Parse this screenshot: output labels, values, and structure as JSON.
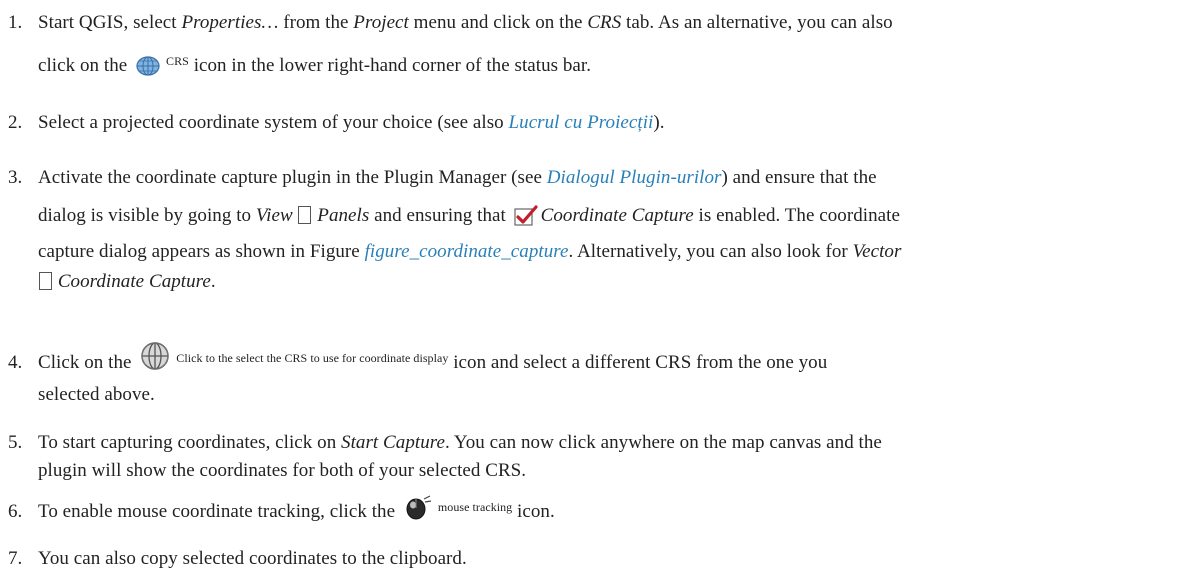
{
  "steps": [
    {
      "num": "1.",
      "p1": "Start QGIS, select ",
      "properties": "Properties…",
      "p2": " from the ",
      "project": "Project",
      "p3": " menu and click on the ",
      "crs_tab": "CRS",
      "p4": " tab. As an alternative, you can also",
      "p5": "click on the ",
      "icon_label": "CRS",
      "p6": " icon in the lower right-hand corner of the status bar."
    },
    {
      "num": "2.",
      "p1": "Select a projected coordinate system of your choice (see also ",
      "link": "Lucrul cu Proiecții",
      "p2": ")."
    },
    {
      "num": "3.",
      "p1": "Activate the coordinate capture plugin in the Plugin Manager (see ",
      "link": "Dialogul Plugin-urilor",
      "p2": ") and ensure that the",
      "p3": "dialog is visible by going to ",
      "view": "View",
      "panels": "Panels",
      "p4": " and ensuring that ",
      "coord_capture": "Coordinate Capture",
      "p5": " is enabled. The coordinate",
      "p6": "capture dialog appears as shown in Figure ",
      "figure_link": "figure_coordinate_capture",
      "p7": ". Alternatively, you can also look for ",
      "vector": "Vector",
      "coord_capture2": "Coordinate Capture",
      "p8": "."
    },
    {
      "num": "4.",
      "p1": "Click on the ",
      "icon_label": "Click to the select the CRS to use for coordinate display",
      "p2": " icon and select a different CRS from the one you",
      "p3": "selected above."
    },
    {
      "num": "5.",
      "p1": "To start capturing coordinates, click on ",
      "start": "Start Capture",
      "p2": ". You can now click anywhere on the map canvas and the",
      "p3": "plugin will show the coordinates for both of your selected CRS."
    },
    {
      "num": "6.",
      "p1": "To enable mouse coordinate tracking, click the ",
      "icon_label": "mouse tracking",
      "p2": " icon."
    },
    {
      "num": "7.",
      "p1": "You can also copy selected coordinates to the clipboard."
    }
  ],
  "colors": {
    "text": "#222222",
    "link": "#2980b9"
  },
  "icons": [
    "globe-crs-icon",
    "checkbox-checked-icon",
    "crosshair-globe-icon",
    "mouse-tracking-icon"
  ]
}
